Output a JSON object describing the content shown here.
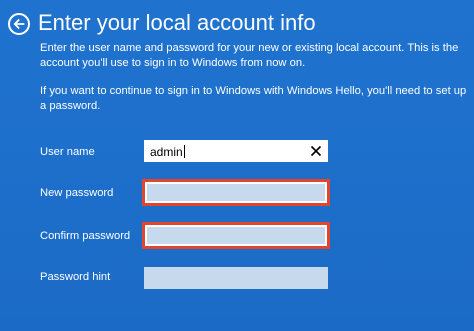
{
  "page": {
    "title": "Enter your local account info",
    "paragraph1": "Enter the user name and password for your new or existing local account. This is the account you'll use to sign in to Windows from now on.",
    "paragraph2": "If you want to continue to sign in to Windows with Windows Hello, you'll need to set up a password."
  },
  "form": {
    "username_label": "User name",
    "username_value": "admin",
    "new_password_label": "New password",
    "confirm_password_label": "Confirm password",
    "password_hint_label": "Password hint"
  },
  "icons": {
    "back": "back-arrow-icon",
    "clear": "close-icon"
  },
  "colors": {
    "background": "#1d6fcb",
    "field_error_border": "#e0452f",
    "field_fill": "#c7d9ec"
  }
}
